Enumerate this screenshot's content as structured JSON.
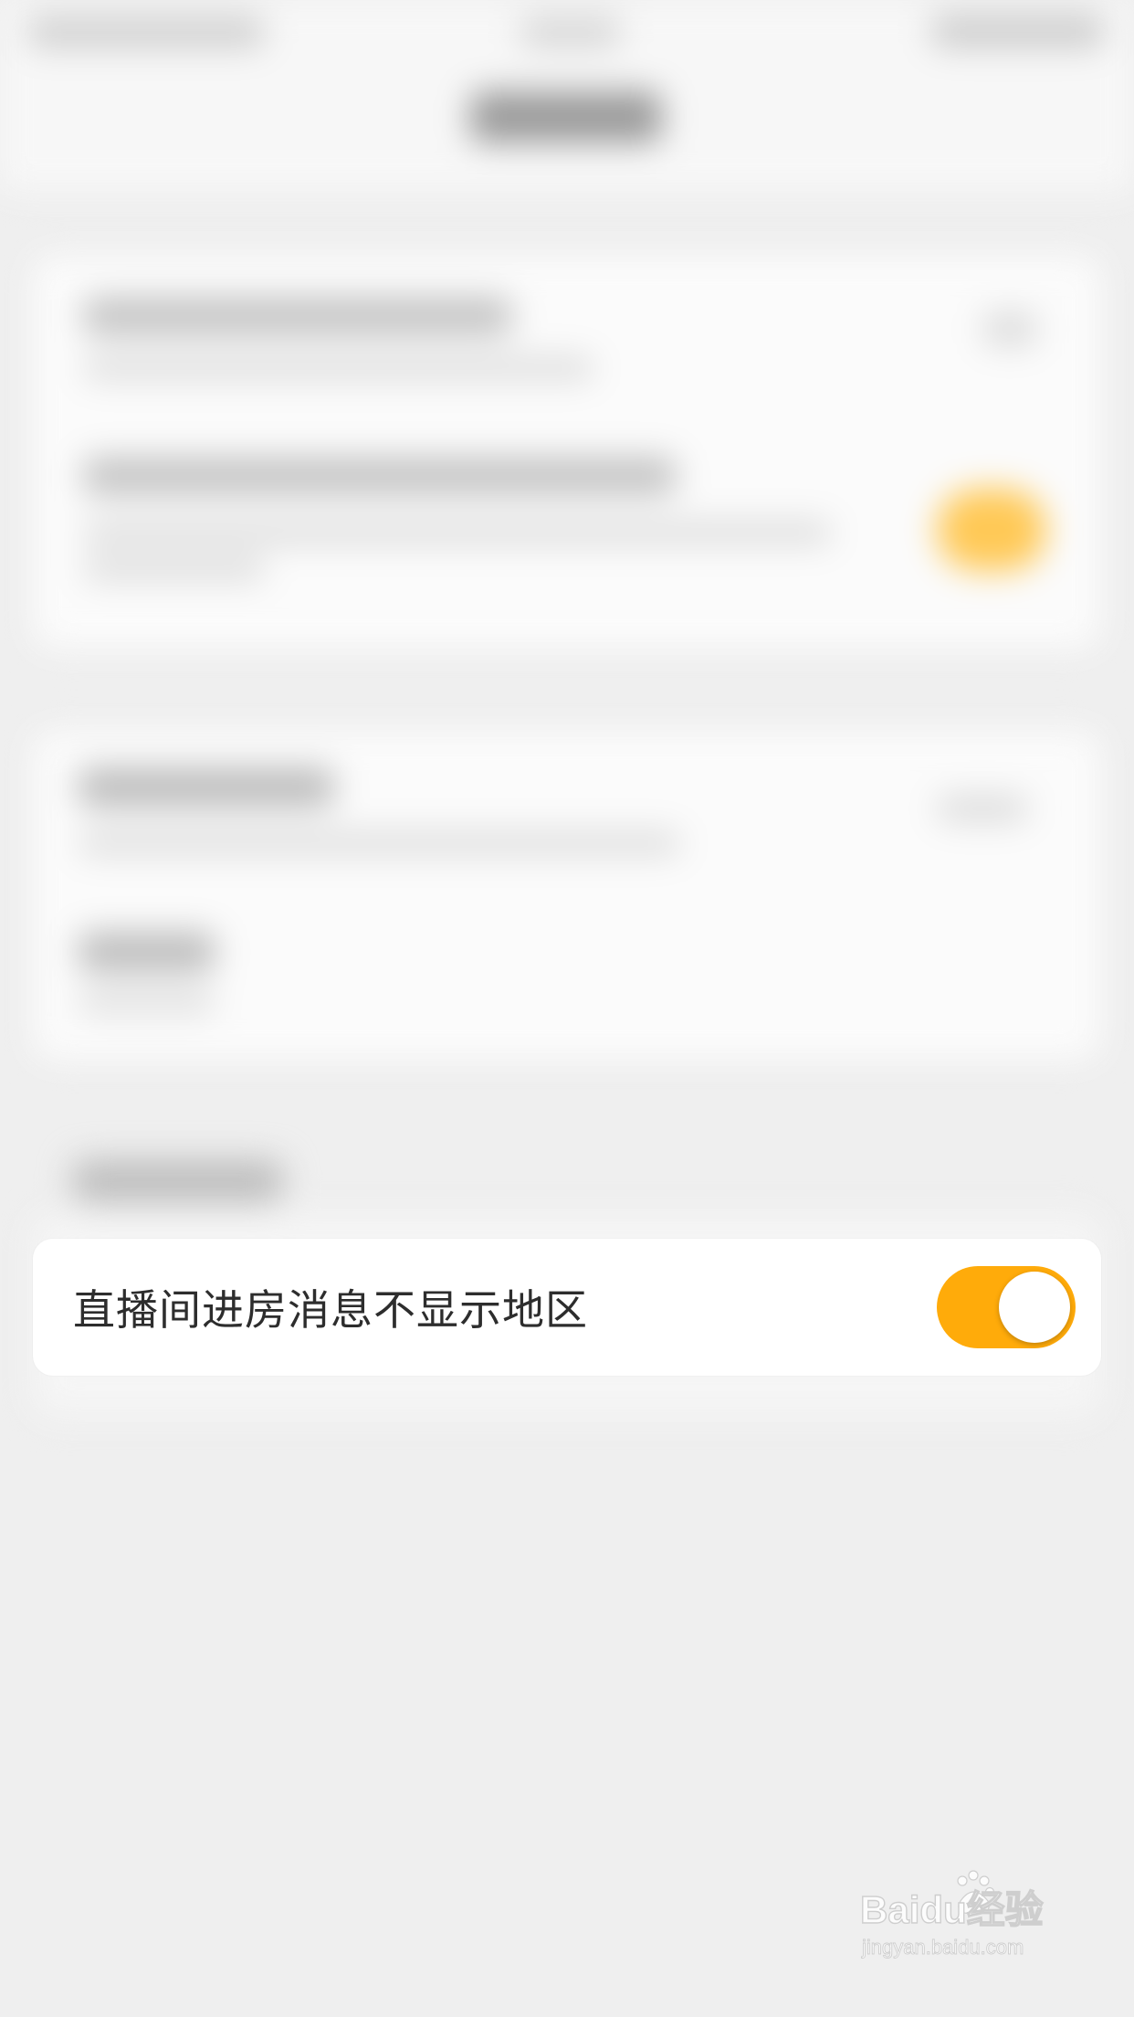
{
  "setting": {
    "label": "直播间进房消息不显示地区",
    "toggle_on": true
  },
  "colors": {
    "toggle_on": "#ffab0a",
    "background": "#efefef",
    "row_background": "#ffffff",
    "label_text": "#2d2d2d"
  },
  "watermark": {
    "logo_text": "Baidu经验",
    "url_text": "jingyan.baidu.com"
  }
}
